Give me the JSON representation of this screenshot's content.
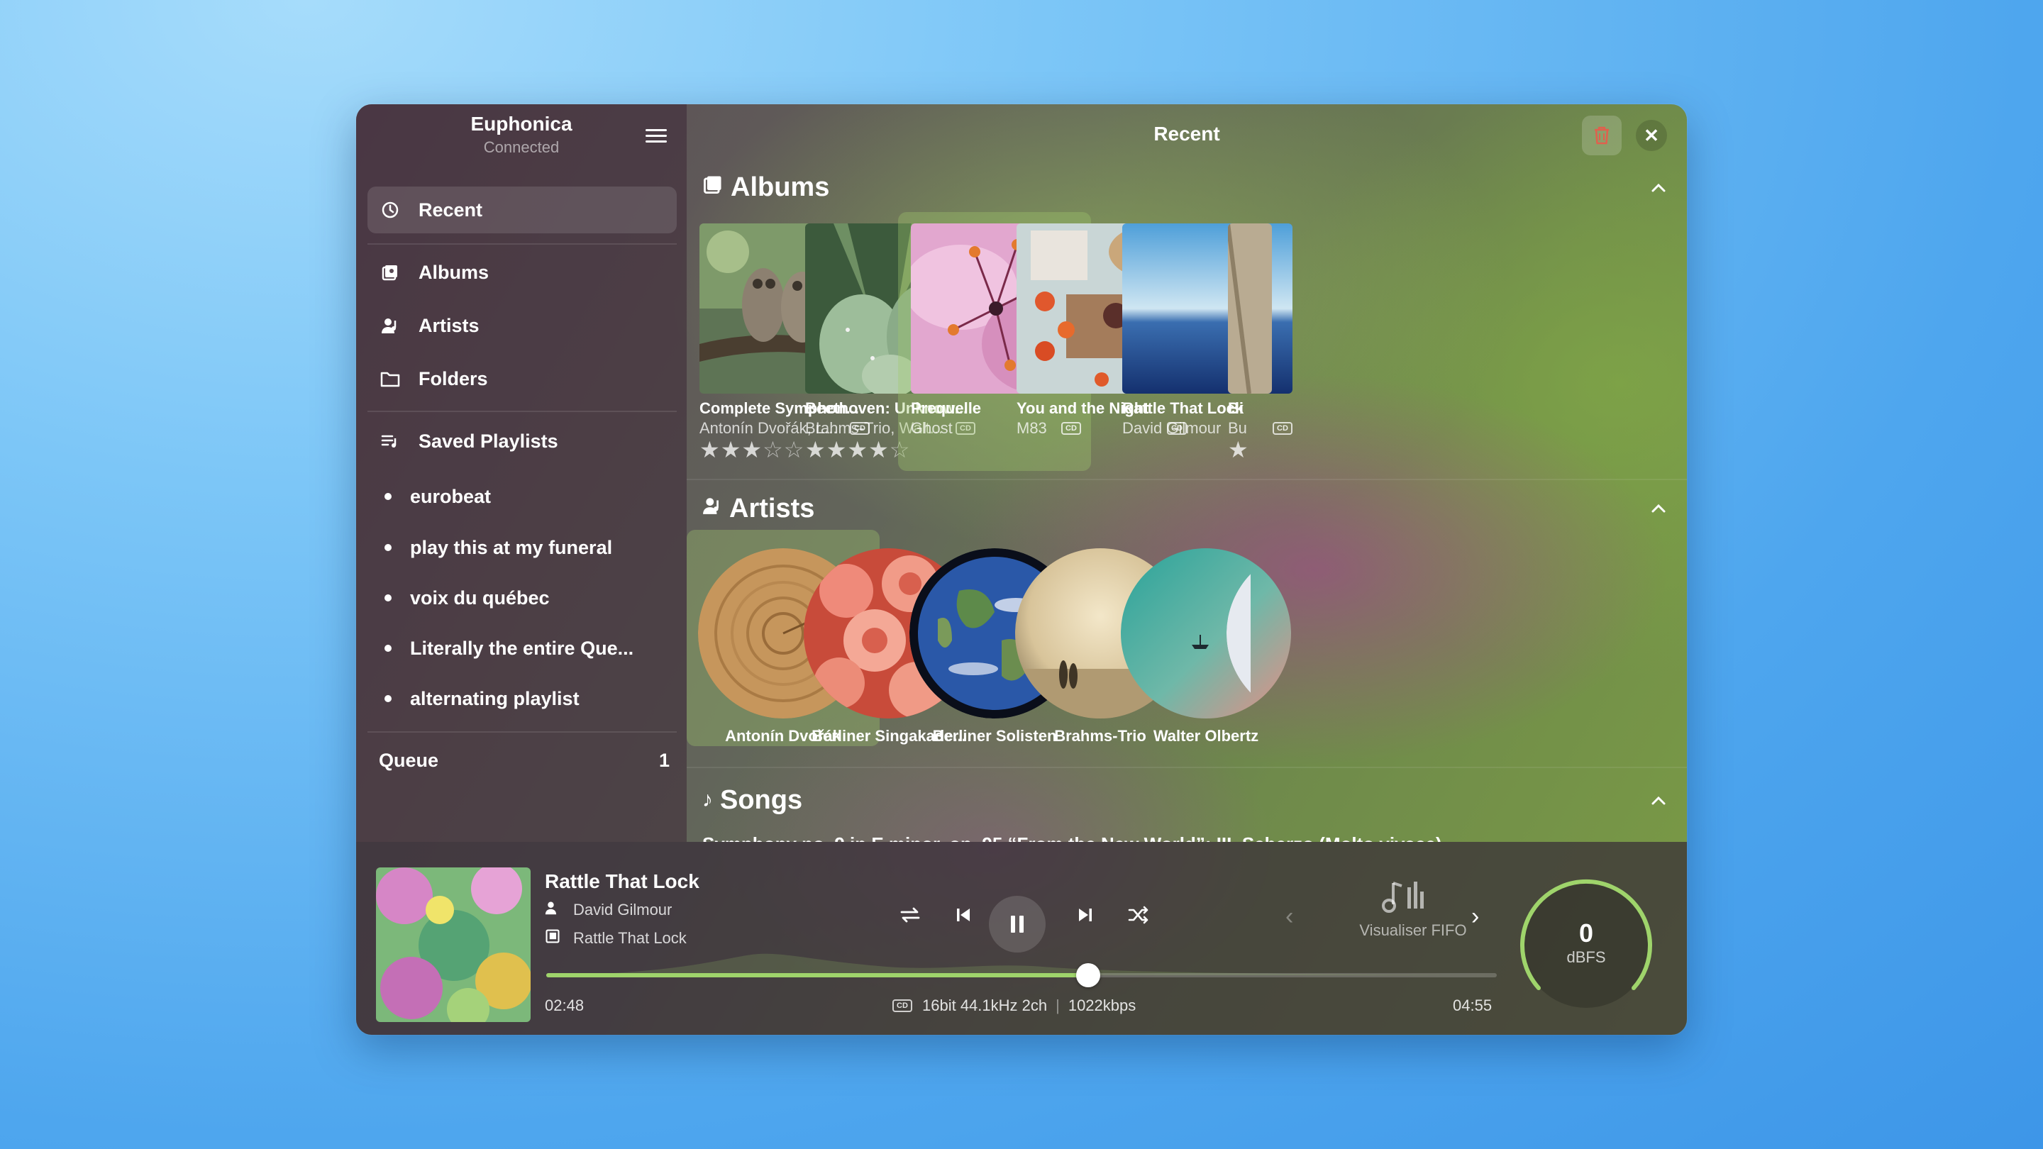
{
  "sidebar": {
    "app_title": "Euphonica",
    "status": "Connected",
    "nav": [
      {
        "label": "Recent",
        "icon": "clock-icon"
      },
      {
        "label": "Albums",
        "icon": "album-icon"
      },
      {
        "label": "Artists",
        "icon": "artist-icon"
      },
      {
        "label": "Folders",
        "icon": "folder-icon"
      },
      {
        "label": "Saved Playlists",
        "icon": "playlist-icon"
      }
    ],
    "playlists": [
      "eurobeat",
      "play this at my funeral",
      "voix du québec",
      "Literally the entire Que...",
      "alternating playlist"
    ],
    "queue_label": "Queue",
    "queue_count": "1"
  },
  "header": {
    "title": "Recent"
  },
  "sections": {
    "albums": "Albums",
    "artists": "Artists",
    "songs": "Songs"
  },
  "albums": [
    {
      "title": "Complete Symphon...",
      "artist": "Antonín Dvořák, L...",
      "badge": "CD",
      "rating": 3
    },
    {
      "title": "Beethoven: Unknow...",
      "artist": "Brahms-Trio, Walt...",
      "badge": "CD",
      "rating": 4
    },
    {
      "title": "Prequelle",
      "artist": "Ghost",
      "badge": "CD",
      "rating": 0
    },
    {
      "title": "You and the Night",
      "artist": "M83",
      "badge": "CD",
      "rating": 0
    },
    {
      "title": "Rattle That Lock",
      "artist": "David Gilmour",
      "badge": "CD",
      "rating": 0
    },
    {
      "title": "Bi",
      "artist": "Bu",
      "badge": "",
      "rating": 1
    }
  ],
  "artists": [
    "Antonín Dvořák",
    "Berliner Singakade...",
    "Berliner Solisten",
    "Brahms-Trio",
    "Walter Olbertz"
  ],
  "songs_peek": "Symphony no. 9 in E minor, op. 95 “From the New World”: III. Scherzo (Molto vivace)",
  "player": {
    "title": "Rattle That Lock",
    "artist": "David Gilmour",
    "album": "Rattle That Lock",
    "elapsed": "02:48",
    "duration": "04:55",
    "progress": 0.57,
    "badge": "CD",
    "format": "16bit 44.1kHz 2ch",
    "bitrate": "1022kbps",
    "visualiser": "Visualiser FIFO",
    "meter_value": "0",
    "meter_unit": "dBFS"
  },
  "colors": {
    "accent": "#9fd46b",
    "trash": "#e0604d"
  }
}
